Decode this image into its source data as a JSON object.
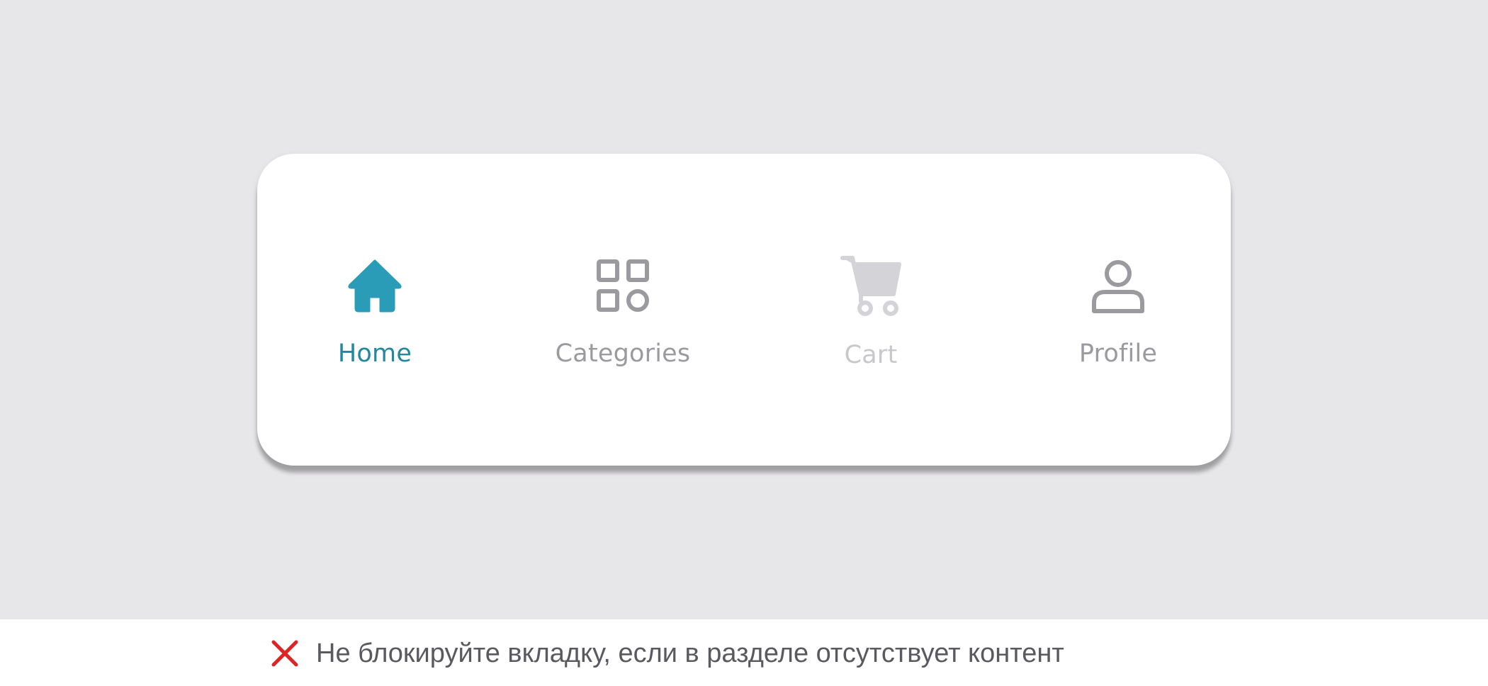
{
  "tabbar": {
    "active_color": "#2a9cb8",
    "inactive_color": "#9b9a9f",
    "disabled_color": "#d4d3d7",
    "items": [
      {
        "label": "Home",
        "icon": "home-icon",
        "state": "active"
      },
      {
        "label": "Categories",
        "icon": "grid-icon",
        "state": "inactive"
      },
      {
        "label": "Cart",
        "icon": "cart-icon",
        "state": "disabled"
      },
      {
        "label": "Profile",
        "icon": "person-icon",
        "state": "inactive"
      }
    ]
  },
  "caption": {
    "icon": "red-x-icon",
    "icon_color": "#e02424",
    "text": "Не блокируйте вкладку, если в разделе отсутствует контент"
  }
}
